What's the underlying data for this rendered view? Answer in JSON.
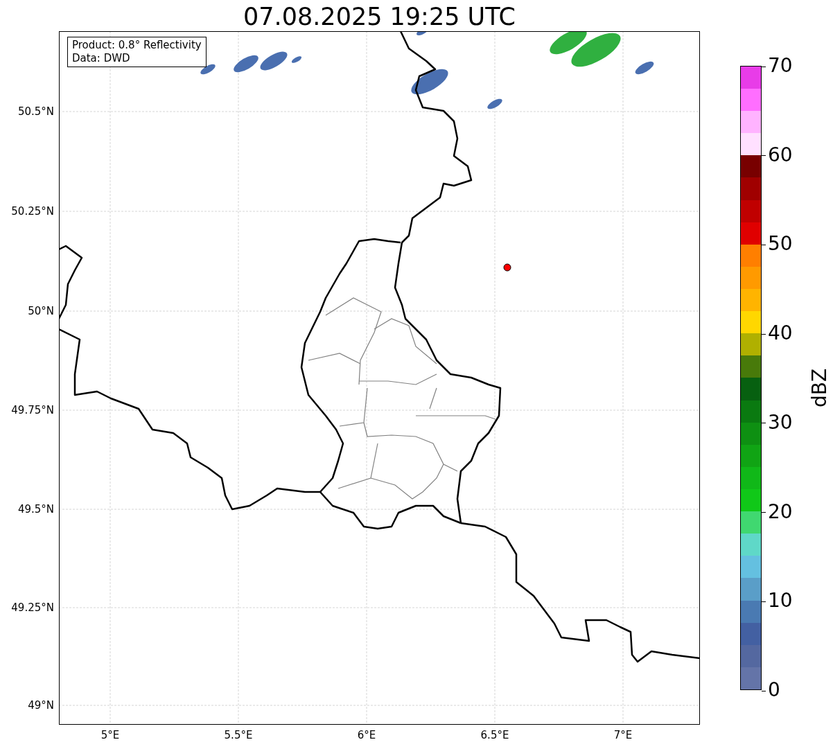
{
  "title": "07.08.2025 19:25 UTC",
  "info_box": [
    "Product: 0.8° Reflectivity",
    "Data: DWD"
  ],
  "lat_labels": [
    "50.5°N",
    "50.25°N",
    "50°N",
    "49.75°N",
    "49.5°N",
    "49.25°N",
    "49°N"
  ],
  "lon_labels": [
    "5°E",
    "5.5°E",
    "6°E",
    "6.5°E",
    "7°E"
  ],
  "colorbar": {
    "label": "dBZ",
    "ticks": [
      "70",
      "60",
      "50",
      "40",
      "30",
      "20",
      "10",
      "0"
    ],
    "bins": [
      {
        "color": "#6474a8"
      },
      {
        "color": "#5468a0"
      },
      {
        "color": "#4360a2"
      },
      {
        "color": "#4a7ab2"
      },
      {
        "color": "#5a9ec8"
      },
      {
        "color": "#64c0e0"
      },
      {
        "color": "#5fd8c8"
      },
      {
        "color": "#40d870"
      },
      {
        "color": "#10c818"
      },
      {
        "color": "#10b818"
      },
      {
        "color": "#10a414"
      },
      {
        "color": "#0e9012"
      },
      {
        "color": "#0a7a10"
      },
      {
        "color": "#076010"
      },
      {
        "color": "#487a0a"
      },
      {
        "color": "#b0b000"
      },
      {
        "color": "#ffd700"
      },
      {
        "color": "#ffb400"
      },
      {
        "color": "#ff9a00"
      },
      {
        "color": "#ff7f00"
      },
      {
        "color": "#e00000"
      },
      {
        "color": "#c00000"
      },
      {
        "color": "#a00000"
      },
      {
        "color": "#780000"
      },
      {
        "color": "#ffe0ff"
      },
      {
        "color": "#ffb3ff"
      },
      {
        "color": "#ff6eff"
      },
      {
        "color": "#e83ce8"
      }
    ]
  }
}
